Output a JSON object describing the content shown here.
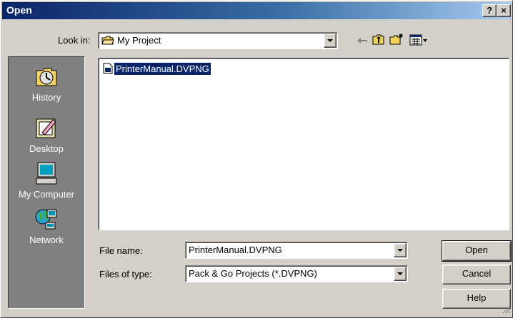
{
  "window": {
    "title": "Open",
    "help_label": "?",
    "close_label": "×"
  },
  "toolbar": {
    "look_in_label": "Look in:",
    "look_in_value": "My Project"
  },
  "places": [
    {
      "label": "History",
      "icon": "history-icon"
    },
    {
      "label": "Desktop",
      "icon": "desktop-icon"
    },
    {
      "label": "My Computer",
      "icon": "computer-icon"
    },
    {
      "label": "Network",
      "icon": "network-icon"
    }
  ],
  "files": [
    {
      "name": "PrinterManual.DVPNG",
      "selected": true
    }
  ],
  "form": {
    "file_name_label": "File name:",
    "file_name_value": "PrinterManual.DVPNG",
    "file_type_label": "Files of type:",
    "file_type_value": "Pack & Go Projects (*.DVPNG)"
  },
  "buttons": {
    "open": "Open",
    "cancel": "Cancel",
    "help": "Help"
  },
  "colors": {
    "title_start": "#0a246a",
    "title_end": "#a6caf0",
    "face": "#d4d0c8",
    "selection": "#0a246a"
  }
}
